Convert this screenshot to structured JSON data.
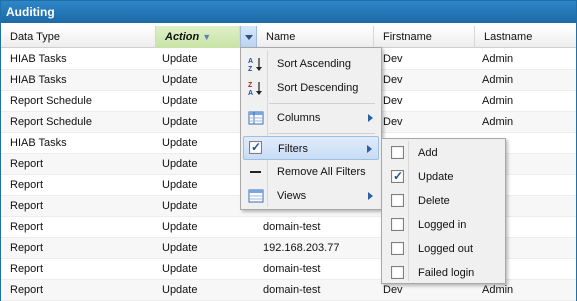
{
  "panel": {
    "title": "Auditing"
  },
  "columns": {
    "data_type": "Data Type",
    "action": "Action",
    "name": "Name",
    "firstname": "Firstname",
    "lastname": "Lastname"
  },
  "rows": [
    {
      "data_type": "HIAB Tasks",
      "action": "Update",
      "name": "",
      "firstname": "Dev",
      "lastname": "Admin"
    },
    {
      "data_type": "HIAB Tasks",
      "action": "Update",
      "name": "",
      "firstname": "Dev",
      "lastname": "Admin"
    },
    {
      "data_type": "Report Schedule",
      "action": "Update",
      "name": "",
      "firstname": "Dev",
      "lastname": "Admin"
    },
    {
      "data_type": "Report Schedule",
      "action": "Update",
      "name": "",
      "firstname": "Dev",
      "lastname": "Admin"
    },
    {
      "data_type": "HIAB Tasks",
      "action": "Update",
      "name": "",
      "firstname": "Dev",
      "lastname": ""
    },
    {
      "data_type": "Report",
      "action": "Update",
      "name": "",
      "firstname": "",
      "lastname": ""
    },
    {
      "data_type": "Report",
      "action": "Update",
      "name": "",
      "firstname": "",
      "lastname": ""
    },
    {
      "data_type": "Report",
      "action": "Update",
      "name": "",
      "firstname": "",
      "lastname": ""
    },
    {
      "data_type": "Report",
      "action": "Update",
      "name": "domain-test",
      "firstname": "",
      "lastname": ""
    },
    {
      "data_type": "Report",
      "action": "Update",
      "name": "192.168.203.77",
      "firstname": "",
      "lastname": ""
    },
    {
      "data_type": "Report",
      "action": "Update",
      "name": "domain-test",
      "firstname": "",
      "lastname": ""
    },
    {
      "data_type": "Report",
      "action": "Update",
      "name": "domain-test",
      "firstname": "Dev",
      "lastname": "Admin"
    }
  ],
  "column_menu": {
    "sort_asc": "Sort Ascending",
    "sort_desc": "Sort Descending",
    "columns": "Columns",
    "filters": "Filters",
    "remove_filters": "Remove All Filters",
    "views": "Views"
  },
  "filter_menu": {
    "items": [
      {
        "label": "Add",
        "checked": false
      },
      {
        "label": "Update",
        "checked": true
      },
      {
        "label": "Delete",
        "checked": false
      },
      {
        "label": "Logged in",
        "checked": false
      },
      {
        "label": "Logged out",
        "checked": false
      },
      {
        "label": "Failed login",
        "checked": false
      }
    ]
  },
  "colors": {
    "accent": "#1c6aa6",
    "active_column": "#c7e3a5",
    "highlight": "#c8dcf5"
  },
  "icons": {
    "sort_asc": "sort-ascending-icon",
    "sort_desc": "sort-descending-icon",
    "columns": "columns-icon",
    "filters": "filter-checkbox-icon",
    "remove_filters": "dash-icon",
    "views": "views-icon",
    "column_menu_trigger": "chevron-down-icon",
    "sort_indicator": "sort-descending-arrow-icon"
  }
}
